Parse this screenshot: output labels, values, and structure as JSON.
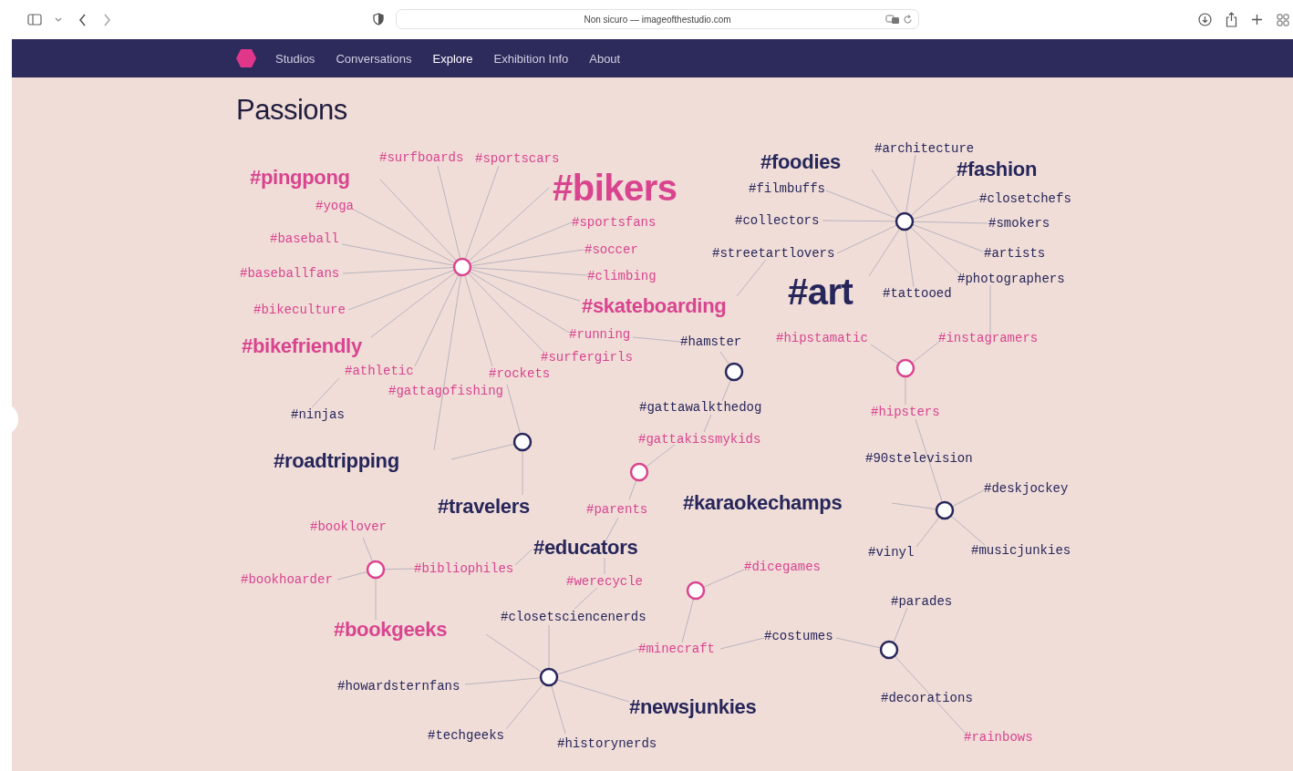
{
  "browser": {
    "address": "Non sicuro — imageofthestudio.com"
  },
  "nav": {
    "items": [
      {
        "label": "Studios",
        "selected": false
      },
      {
        "label": "Conversations",
        "selected": false
      },
      {
        "label": "Explore",
        "selected": true
      },
      {
        "label": "Exhibition Info",
        "selected": false
      },
      {
        "label": "About",
        "selected": false
      }
    ]
  },
  "page_title": "Passions",
  "hubs": [
    {
      "color": "#d9448f"
    },
    {
      "color": "#26265a"
    },
    {
      "color": "#26265a"
    },
    {
      "color": "#26265a"
    },
    {
      "color": "#d9448f"
    },
    {
      "color": "#d9448f"
    },
    {
      "color": "#26265a"
    },
    {
      "color": "#d9448f"
    },
    {
      "color": "#d9448f"
    },
    {
      "color": "#26265a"
    },
    {
      "color": "#26265a"
    }
  ],
  "tags": [
    {
      "text": "#architecture",
      "kind": "small",
      "color": "#26265a"
    },
    {
      "text": "#surfboards",
      "kind": "small",
      "color": "#d9448f"
    },
    {
      "text": "#sportscars",
      "kind": "small",
      "color": "#d9448f"
    },
    {
      "text": "#foodies",
      "kind": "large",
      "color": "#26265a"
    },
    {
      "text": "#fashion",
      "kind": "large",
      "color": "#26265a"
    },
    {
      "text": "#pingpong",
      "kind": "large",
      "color": "#d9448f"
    },
    {
      "text": "#bikers",
      "kind": "huge",
      "color": "#d9448f"
    },
    {
      "text": "#filmbuffs",
      "kind": "small",
      "color": "#26265a"
    },
    {
      "text": "#closetchefs",
      "kind": "small",
      "color": "#26265a"
    },
    {
      "text": "#yoga",
      "kind": "small",
      "color": "#d9448f"
    },
    {
      "text": "#sportsfans",
      "kind": "small",
      "color": "#d9448f"
    },
    {
      "text": "#collectors",
      "kind": "small",
      "color": "#26265a"
    },
    {
      "text": "#smokers",
      "kind": "small",
      "color": "#26265a"
    },
    {
      "text": "#baseball",
      "kind": "small",
      "color": "#d9448f"
    },
    {
      "text": "#soccer",
      "kind": "small",
      "color": "#d9448f"
    },
    {
      "text": "#streetartlovers",
      "kind": "small",
      "color": "#26265a"
    },
    {
      "text": "#artists",
      "kind": "small",
      "color": "#26265a"
    },
    {
      "text": "#baseballfans",
      "kind": "small",
      "color": "#d9448f"
    },
    {
      "text": "#climbing",
      "kind": "small",
      "color": "#d9448f"
    },
    {
      "text": "#photographers",
      "kind": "small",
      "color": "#26265a"
    },
    {
      "text": "#art",
      "kind": "huge",
      "color": "#26265a"
    },
    {
      "text": "#tattooed",
      "kind": "small",
      "color": "#26265a"
    },
    {
      "text": "#bikeculture",
      "kind": "small",
      "color": "#d9448f"
    },
    {
      "text": "#skateboarding",
      "kind": "large",
      "color": "#d9448f"
    },
    {
      "text": "#running",
      "kind": "small",
      "color": "#d9448f"
    },
    {
      "text": "#hamster",
      "kind": "small",
      "color": "#26265a"
    },
    {
      "text": "#hipstamatic",
      "kind": "small",
      "color": "#d9448f"
    },
    {
      "text": "#instagramers",
      "kind": "small",
      "color": "#d9448f"
    },
    {
      "text": "#bikefriendly",
      "kind": "large",
      "color": "#d9448f"
    },
    {
      "text": "#surfergirls",
      "kind": "small",
      "color": "#d9448f"
    },
    {
      "text": "#athletic",
      "kind": "small",
      "color": "#d9448f"
    },
    {
      "text": "#rockets",
      "kind": "small",
      "color": "#d9448f"
    },
    {
      "text": "#gattagofishing",
      "kind": "small",
      "color": "#d9448f"
    },
    {
      "text": "#ninjas",
      "kind": "small",
      "color": "#26265a"
    },
    {
      "text": "#gattawalkthedog",
      "kind": "small",
      "color": "#26265a"
    },
    {
      "text": "#hipsters",
      "kind": "small",
      "color": "#d9448f"
    },
    {
      "text": "#gattakissmykids",
      "kind": "small",
      "color": "#d9448f"
    },
    {
      "text": "#roadtripping",
      "kind": "large",
      "color": "#26265a"
    },
    {
      "text": "#90stelevision",
      "kind": "small",
      "color": "#26265a"
    },
    {
      "text": "#deskjockey",
      "kind": "small",
      "color": "#26265a"
    },
    {
      "text": "#travelers",
      "kind": "large",
      "color": "#26265a"
    },
    {
      "text": "#parents",
      "kind": "small",
      "color": "#d9448f"
    },
    {
      "text": "#karaokechamps",
      "kind": "large",
      "color": "#26265a"
    },
    {
      "text": "#booklover",
      "kind": "small",
      "color": "#d9448f"
    },
    {
      "text": "#educators",
      "kind": "large",
      "color": "#26265a"
    },
    {
      "text": "#vinyl",
      "kind": "small",
      "color": "#26265a"
    },
    {
      "text": "#musicjunkies",
      "kind": "small",
      "color": "#26265a"
    },
    {
      "text": "#bibliophiles",
      "kind": "small",
      "color": "#d9448f"
    },
    {
      "text": "#dicegames",
      "kind": "small",
      "color": "#d9448f"
    },
    {
      "text": "#bookhoarder",
      "kind": "small",
      "color": "#d9448f"
    },
    {
      "text": "#werecycle",
      "kind": "small",
      "color": "#d9448f"
    },
    {
      "text": "#parades",
      "kind": "small",
      "color": "#26265a"
    },
    {
      "text": "#closetsciencenerds",
      "kind": "small",
      "color": "#26265a"
    },
    {
      "text": "#bookgeeks",
      "kind": "large",
      "color": "#d9448f"
    },
    {
      "text": "#costumes",
      "kind": "small",
      "color": "#26265a"
    },
    {
      "text": "#minecraft",
      "kind": "small",
      "color": "#d9448f"
    },
    {
      "text": "#howardsternfans",
      "kind": "small",
      "color": "#26265a"
    },
    {
      "text": "#decorations",
      "kind": "small",
      "color": "#26265a"
    },
    {
      "text": "#newsjunkies",
      "kind": "large",
      "color": "#26265a"
    },
    {
      "text": "#techgeeks",
      "kind": "small",
      "color": "#26265a"
    },
    {
      "text": "#rainbows",
      "kind": "small",
      "color": "#d9448f"
    },
    {
      "text": "#historynerds",
      "kind": "small",
      "color": "#26265a"
    }
  ]
}
